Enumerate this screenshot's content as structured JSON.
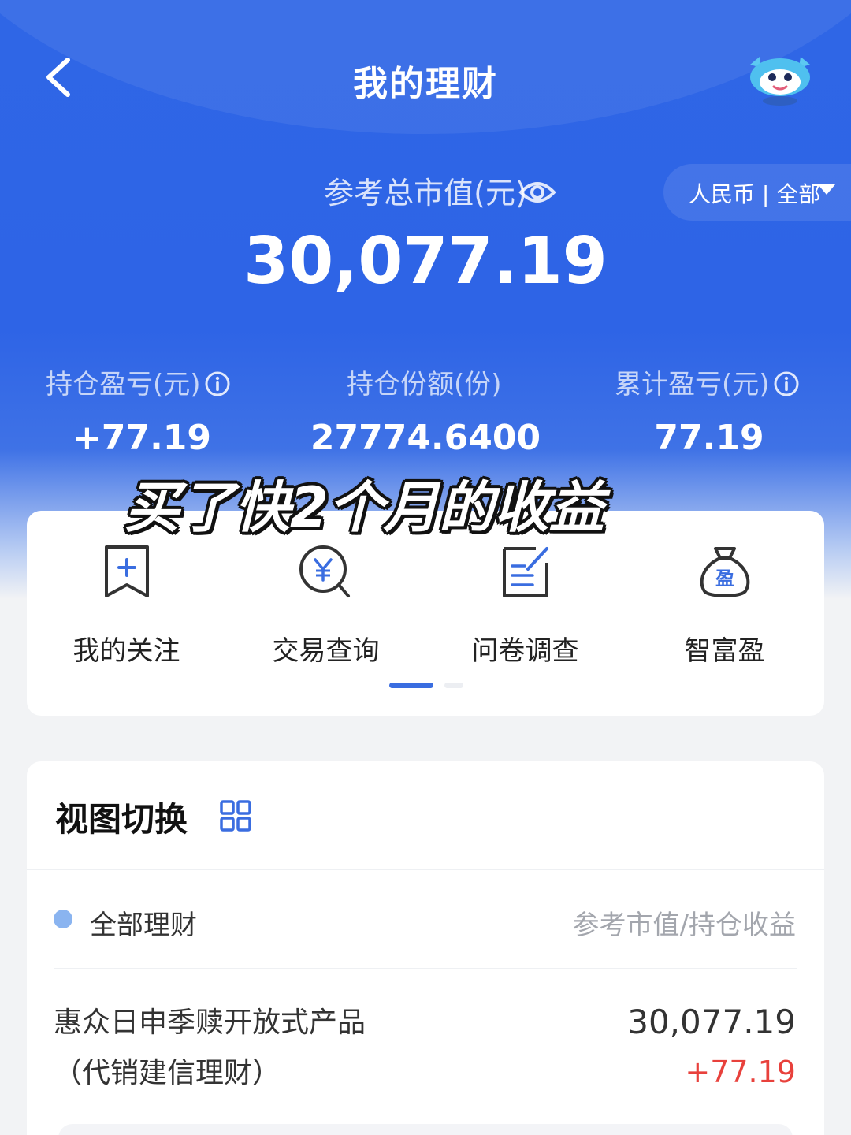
{
  "header": {
    "title": "我的理财"
  },
  "summary": {
    "total_label": "参考总市值(元)",
    "total_value": "30,077.19",
    "currency_filter": "人民币 | 全部"
  },
  "stats": [
    {
      "label": "持仓盈亏(元)",
      "value": "+77.19",
      "has_info": true
    },
    {
      "label": "持仓份额(份)",
      "value": "27774.6400",
      "has_info": false
    },
    {
      "label": "累计盈亏(元)",
      "value": "77.19",
      "has_info": true
    }
  ],
  "overlay_caption": "买了快2个月的收益",
  "menu": {
    "items": [
      {
        "label": "我的关注",
        "icon": "bookmark-plus-icon"
      },
      {
        "label": "交易查询",
        "icon": "yuan-search-icon"
      },
      {
        "label": "问卷调查",
        "icon": "survey-edit-icon"
      },
      {
        "label": "智富盈",
        "icon": "money-bag-icon",
        "icon_text": "盈"
      }
    ],
    "page_indicator": {
      "current": 1,
      "total": 2
    }
  },
  "portfolio": {
    "view_title": "视图切换",
    "filter_label": "全部理财",
    "column_header": "参考市值/持仓收益",
    "products": [
      {
        "name": "惠众日申季赎开放式产品（代销建信理财）",
        "market_value": "30,077.19",
        "gain": "+77.19"
      }
    ]
  },
  "colors": {
    "primary_blue": "#2f66e6",
    "accent_blue": "#3a6de0",
    "gain_red": "#e8413c"
  }
}
